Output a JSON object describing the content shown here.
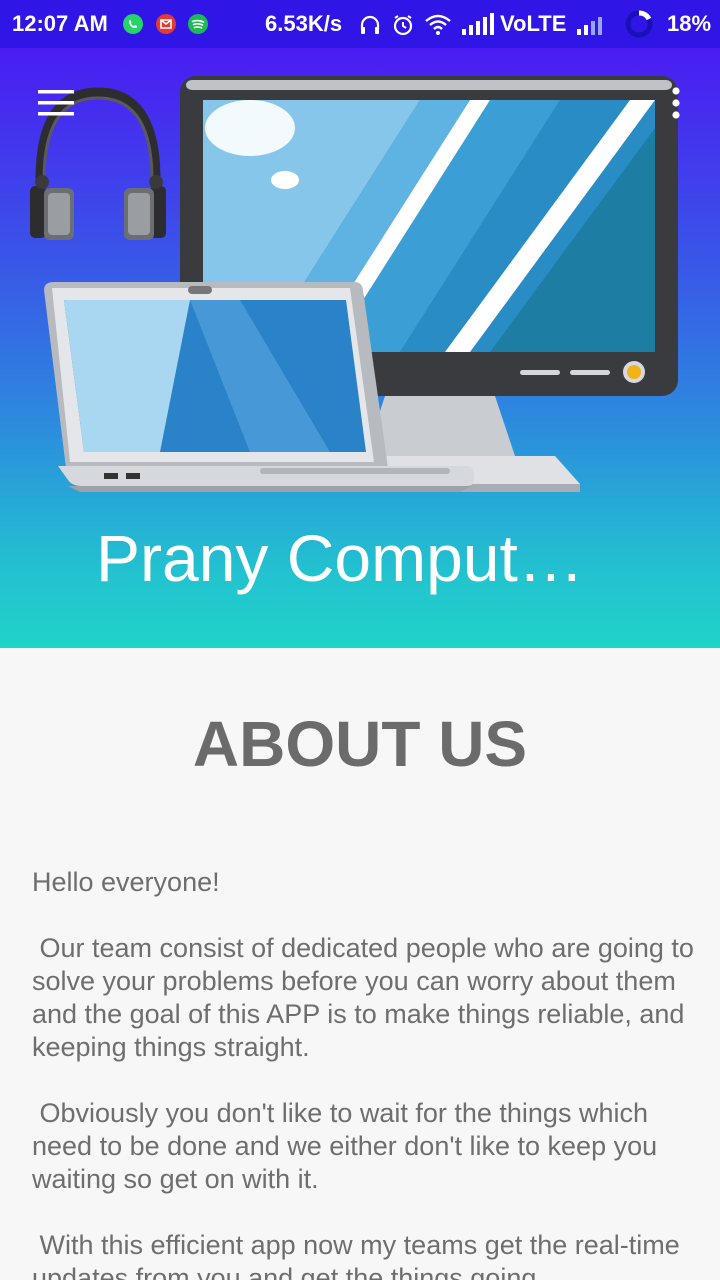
{
  "status_bar": {
    "time": "12:07 AM",
    "net_speed": "6.53K/s",
    "network": "VoLTE",
    "battery": "18%"
  },
  "header": {
    "title": "Prany Comput…"
  },
  "about": {
    "heading": "ABOUT US",
    "paragraphs": [
      "Hello everyone!",
      " Our team consist of dedicated people who are going to solve your problems before you can worry about them and the goal of this APP is to make things reliable, and keeping things straight.",
      " Obviously you don't like to wait for the things which need to be done and we either don't like to keep you waiting so get on with it.",
      " With this efficient app now my teams get the real-time updates from you and get the things going"
    ]
  },
  "colors": {
    "status_bar": "#2f16e6",
    "header_top": "#4a1cf2",
    "header_bottom": "#1fd3c8",
    "text_gray": "#6e6e6e"
  }
}
